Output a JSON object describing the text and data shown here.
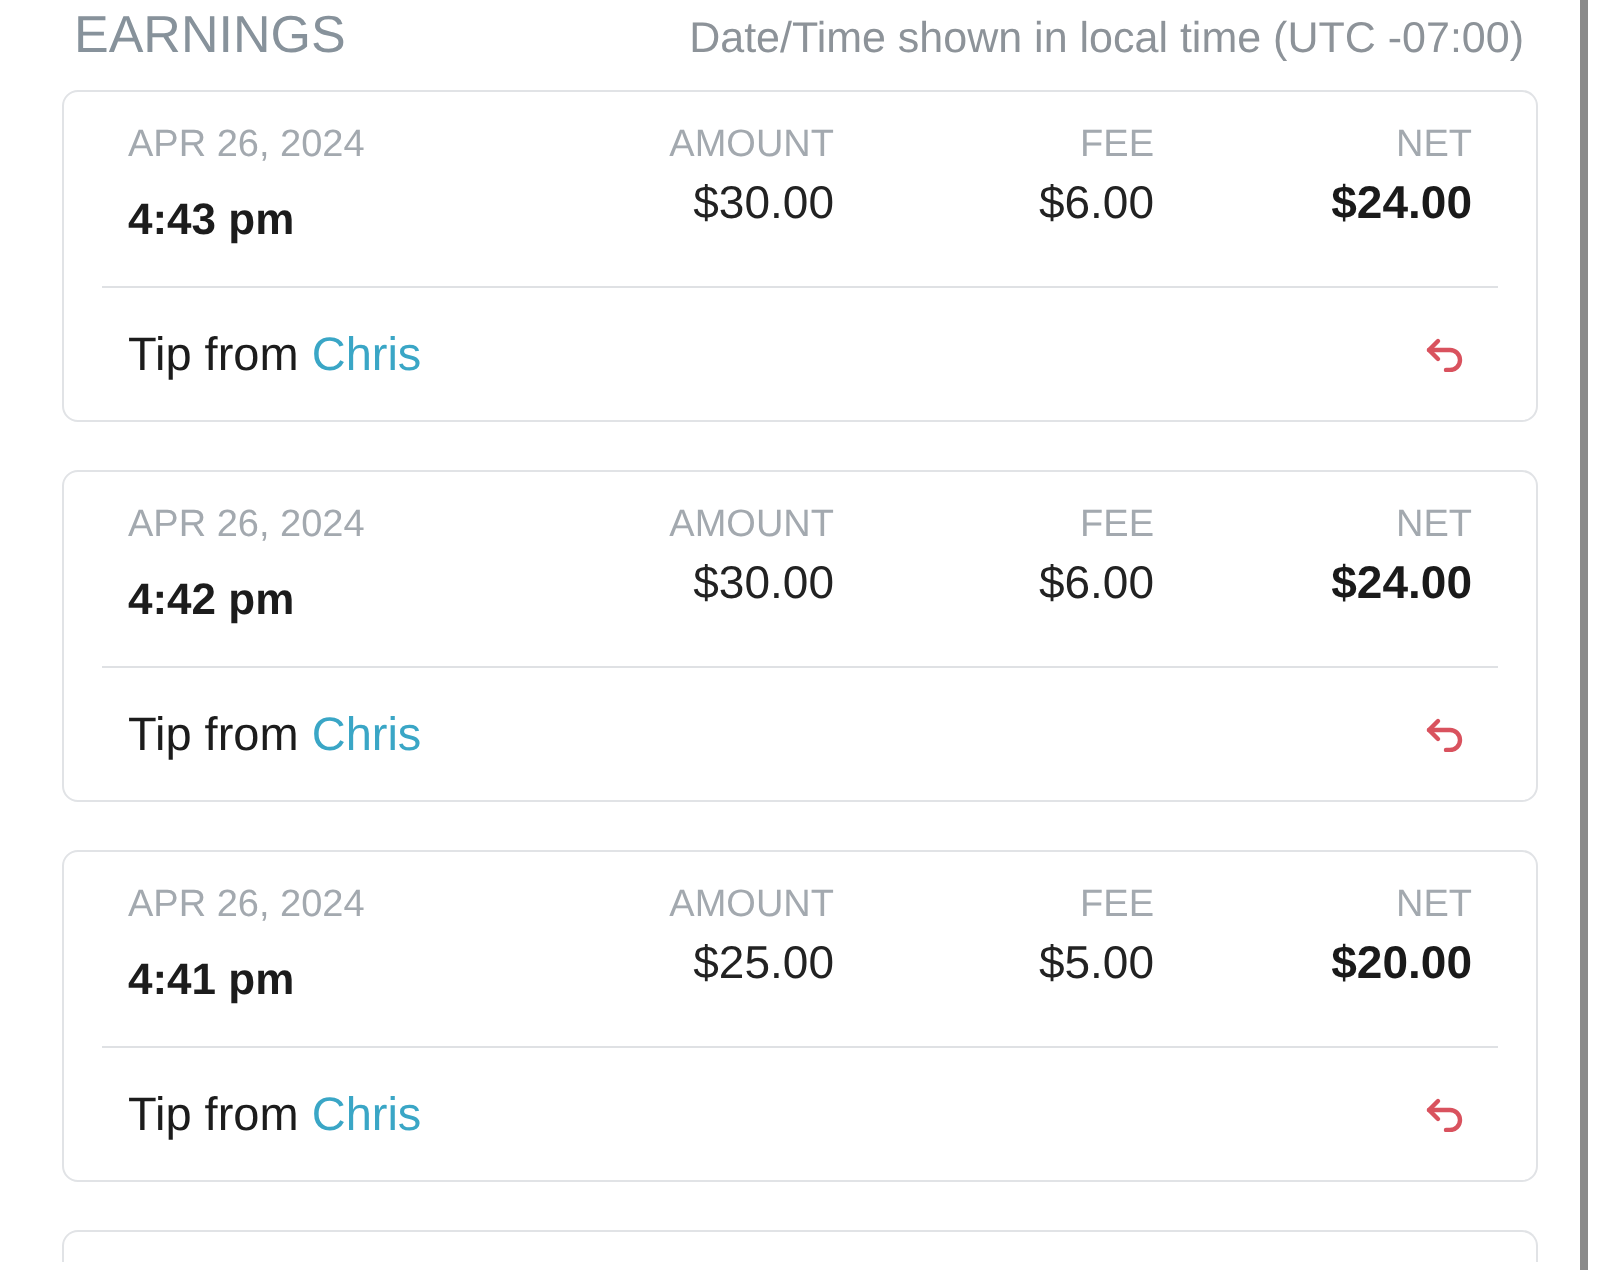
{
  "header": {
    "title": "EARNINGS",
    "timezone_note": "Date/Time shown in local time (UTC -07:00)"
  },
  "transactions": [
    {
      "date": "APR 26, 2024",
      "time": "4:43 pm",
      "amount_label": "AMOUNT",
      "amount": "$30.00",
      "fee_label": "FEE",
      "fee": "$6.00",
      "net_label": "NET",
      "net": "$24.00",
      "description": "Tip from",
      "sender": "Chris"
    },
    {
      "date": "APR 26, 2024",
      "time": "4:42 pm",
      "amount_label": "AMOUNT",
      "amount": "$30.00",
      "fee_label": "FEE",
      "fee": "$6.00",
      "net_label": "NET",
      "net": "$24.00",
      "description": "Tip from",
      "sender": "Chris"
    },
    {
      "date": "APR 26, 2024",
      "time": "4:41 pm",
      "amount_label": "AMOUNT",
      "amount": "$25.00",
      "fee_label": "FEE",
      "fee": "$5.00",
      "net_label": "NET",
      "net": "$20.00",
      "description": "Tip from",
      "sender": "Chris"
    }
  ],
  "more_cards_below": true
}
